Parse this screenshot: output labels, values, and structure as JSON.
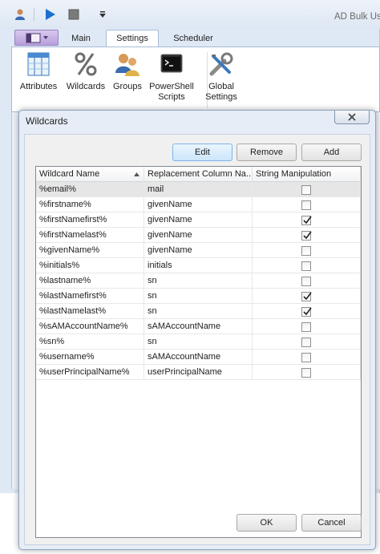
{
  "app": {
    "title": "AD Bulk Us",
    "tabs": [
      {
        "label": "Main"
      },
      {
        "label": "Settings"
      },
      {
        "label": "Scheduler"
      }
    ],
    "ribbon_buttons": [
      {
        "label": "Attributes",
        "icon": "attributes-icon"
      },
      {
        "label": "Wildcards",
        "icon": "percent-icon"
      },
      {
        "label": "Groups",
        "icon": "users-group-icon"
      },
      {
        "label": "PowerShell Scripts",
        "icon": "powershell-icon"
      },
      {
        "label": "Global Settings",
        "icon": "tools-icon"
      }
    ]
  },
  "dialog": {
    "title": "Wildcards",
    "buttons": {
      "edit": "Edit",
      "remove": "Remove",
      "add": "Add",
      "ok": "OK",
      "cancel": "Cancel"
    },
    "columns": [
      "Wildcard Name",
      "Replacement Column Na...",
      "String Manipulation"
    ],
    "rows": [
      {
        "wildcard": "%email%",
        "replacement": "mail",
        "string_manipulation": false
      },
      {
        "wildcard": "%firstname%",
        "replacement": "givenName",
        "string_manipulation": false
      },
      {
        "wildcard": "%firstNamefirst%",
        "replacement": "givenName",
        "string_manipulation": true
      },
      {
        "wildcard": "%firstNamelast%",
        "replacement": "givenName",
        "string_manipulation": true
      },
      {
        "wildcard": "%givenName%",
        "replacement": "givenName",
        "string_manipulation": false
      },
      {
        "wildcard": "%initials%",
        "replacement": "initials",
        "string_manipulation": false
      },
      {
        "wildcard": "%lastname%",
        "replacement": "sn",
        "string_manipulation": false
      },
      {
        "wildcard": "%lastNamefirst%",
        "replacement": "sn",
        "string_manipulation": true
      },
      {
        "wildcard": "%lastNamelast%",
        "replacement": "sn",
        "string_manipulation": true
      },
      {
        "wildcard": "%sAMAccountName%",
        "replacement": "sAMAccountName",
        "string_manipulation": false
      },
      {
        "wildcard": "%sn%",
        "replacement": "sn",
        "string_manipulation": false
      },
      {
        "wildcard": "%username%",
        "replacement": "sAMAccountName",
        "string_manipulation": false
      },
      {
        "wildcard": "%userPrincipalName%",
        "replacement": "userPrincipalName",
        "string_manipulation": false
      }
    ]
  },
  "colors": {
    "accent": "#1c6fd1",
    "selected_row": "#e6e6e6"
  }
}
